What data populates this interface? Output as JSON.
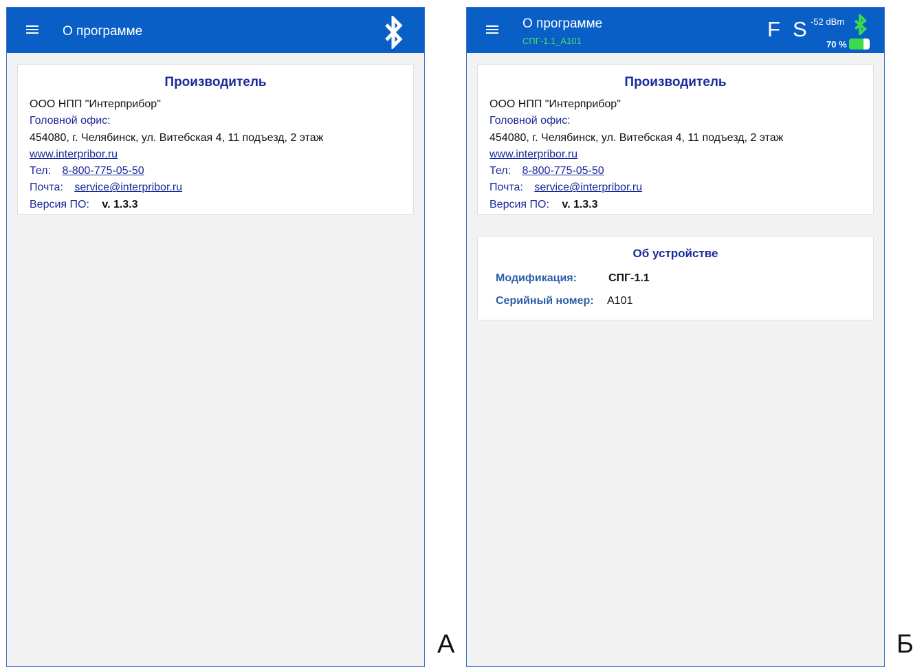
{
  "screens": [
    {
      "appbar": {
        "title": "О программе"
      },
      "manufacturer": {
        "heading": "Производитель",
        "company": "ООО НПП \"Интерприбор\"",
        "office_label": "Головной офис:",
        "address": "454080, г. Челябинск, ул. Витебская 4, 11 подъезд, 2 этаж",
        "website": "www.interpribor.ru",
        "phone_label": "Тел:",
        "phone": "8-800-775-05-50",
        "email_label": "Почта:",
        "email": "service@interpribor.ru",
        "version_label": "Версия ПО:",
        "version": "v. 1.3.3"
      },
      "corner_letter": "А"
    },
    {
      "appbar": {
        "title": "О программе",
        "subtitle": "СПГ-1.1_A101",
        "f_label": "F",
        "s_label": "S",
        "signal": "-52 dBm",
        "battery_text": "70 %",
        "battery_level": 0.7
      },
      "manufacturer": {
        "heading": "Производитель",
        "company": "ООО НПП \"Интерприбор\"",
        "office_label": "Головной офис:",
        "address": "454080, г. Челябинск, ул. Витебская 4, 11 подъезд, 2 этаж",
        "website": "www.interpribor.ru",
        "phone_label": "Тел:",
        "phone": "8-800-775-05-50",
        "email_label": "Почта:",
        "email": "service@interpribor.ru",
        "version_label": "Версия ПО:",
        "version": "v. 1.3.3"
      },
      "device": {
        "heading": "Об устройстве",
        "modification_label": "Модификация:",
        "modification": "СПГ-1.1",
        "serial_label": "Серийный номер:",
        "serial": "A101"
      },
      "corner_letter": "Б"
    }
  ],
  "colors": {
    "appbar": "#0a5fc7",
    "accent_text": "#1a2a9a",
    "status_green": "#3bd94e"
  }
}
